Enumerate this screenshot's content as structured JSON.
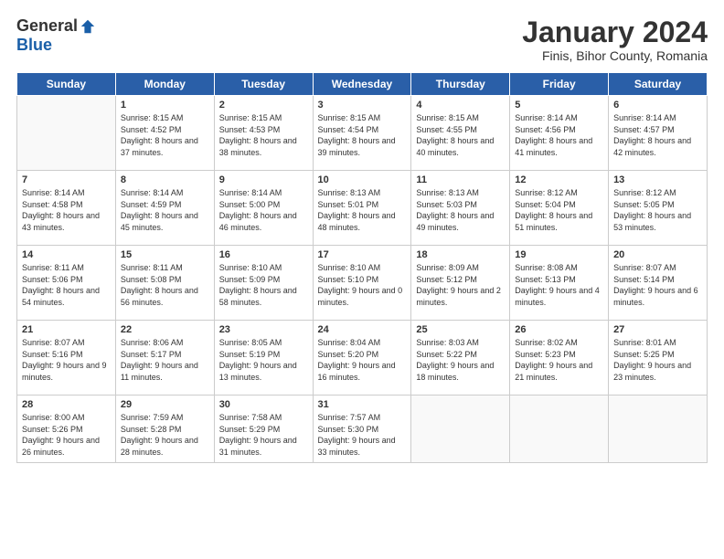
{
  "header": {
    "logo_general": "General",
    "logo_blue": "Blue",
    "title": "January 2024",
    "subtitle": "Finis, Bihor County, Romania"
  },
  "days": [
    "Sunday",
    "Monday",
    "Tuesday",
    "Wednesday",
    "Thursday",
    "Friday",
    "Saturday"
  ],
  "weeks": [
    [
      {
        "date": "",
        "sunrise": "",
        "sunset": "",
        "daylight": ""
      },
      {
        "date": "1",
        "sunrise": "Sunrise: 8:15 AM",
        "sunset": "Sunset: 4:52 PM",
        "daylight": "Daylight: 8 hours and 37 minutes."
      },
      {
        "date": "2",
        "sunrise": "Sunrise: 8:15 AM",
        "sunset": "Sunset: 4:53 PM",
        "daylight": "Daylight: 8 hours and 38 minutes."
      },
      {
        "date": "3",
        "sunrise": "Sunrise: 8:15 AM",
        "sunset": "Sunset: 4:54 PM",
        "daylight": "Daylight: 8 hours and 39 minutes."
      },
      {
        "date": "4",
        "sunrise": "Sunrise: 8:15 AM",
        "sunset": "Sunset: 4:55 PM",
        "daylight": "Daylight: 8 hours and 40 minutes."
      },
      {
        "date": "5",
        "sunrise": "Sunrise: 8:14 AM",
        "sunset": "Sunset: 4:56 PM",
        "daylight": "Daylight: 8 hours and 41 minutes."
      },
      {
        "date": "6",
        "sunrise": "Sunrise: 8:14 AM",
        "sunset": "Sunset: 4:57 PM",
        "daylight": "Daylight: 8 hours and 42 minutes."
      }
    ],
    [
      {
        "date": "7",
        "sunrise": "Sunrise: 8:14 AM",
        "sunset": "Sunset: 4:58 PM",
        "daylight": "Daylight: 8 hours and 43 minutes."
      },
      {
        "date": "8",
        "sunrise": "Sunrise: 8:14 AM",
        "sunset": "Sunset: 4:59 PM",
        "daylight": "Daylight: 8 hours and 45 minutes."
      },
      {
        "date": "9",
        "sunrise": "Sunrise: 8:14 AM",
        "sunset": "Sunset: 5:00 PM",
        "daylight": "Daylight: 8 hours and 46 minutes."
      },
      {
        "date": "10",
        "sunrise": "Sunrise: 8:13 AM",
        "sunset": "Sunset: 5:01 PM",
        "daylight": "Daylight: 8 hours and 48 minutes."
      },
      {
        "date": "11",
        "sunrise": "Sunrise: 8:13 AM",
        "sunset": "Sunset: 5:03 PM",
        "daylight": "Daylight: 8 hours and 49 minutes."
      },
      {
        "date": "12",
        "sunrise": "Sunrise: 8:12 AM",
        "sunset": "Sunset: 5:04 PM",
        "daylight": "Daylight: 8 hours and 51 minutes."
      },
      {
        "date": "13",
        "sunrise": "Sunrise: 8:12 AM",
        "sunset": "Sunset: 5:05 PM",
        "daylight": "Daylight: 8 hours and 53 minutes."
      }
    ],
    [
      {
        "date": "14",
        "sunrise": "Sunrise: 8:11 AM",
        "sunset": "Sunset: 5:06 PM",
        "daylight": "Daylight: 8 hours and 54 minutes."
      },
      {
        "date": "15",
        "sunrise": "Sunrise: 8:11 AM",
        "sunset": "Sunset: 5:08 PM",
        "daylight": "Daylight: 8 hours and 56 minutes."
      },
      {
        "date": "16",
        "sunrise": "Sunrise: 8:10 AM",
        "sunset": "Sunset: 5:09 PM",
        "daylight": "Daylight: 8 hours and 58 minutes."
      },
      {
        "date": "17",
        "sunrise": "Sunrise: 8:10 AM",
        "sunset": "Sunset: 5:10 PM",
        "daylight": "Daylight: 9 hours and 0 minutes."
      },
      {
        "date": "18",
        "sunrise": "Sunrise: 8:09 AM",
        "sunset": "Sunset: 5:12 PM",
        "daylight": "Daylight: 9 hours and 2 minutes."
      },
      {
        "date": "19",
        "sunrise": "Sunrise: 8:08 AM",
        "sunset": "Sunset: 5:13 PM",
        "daylight": "Daylight: 9 hours and 4 minutes."
      },
      {
        "date": "20",
        "sunrise": "Sunrise: 8:07 AM",
        "sunset": "Sunset: 5:14 PM",
        "daylight": "Daylight: 9 hours and 6 minutes."
      }
    ],
    [
      {
        "date": "21",
        "sunrise": "Sunrise: 8:07 AM",
        "sunset": "Sunset: 5:16 PM",
        "daylight": "Daylight: 9 hours and 9 minutes."
      },
      {
        "date": "22",
        "sunrise": "Sunrise: 8:06 AM",
        "sunset": "Sunset: 5:17 PM",
        "daylight": "Daylight: 9 hours and 11 minutes."
      },
      {
        "date": "23",
        "sunrise": "Sunrise: 8:05 AM",
        "sunset": "Sunset: 5:19 PM",
        "daylight": "Daylight: 9 hours and 13 minutes."
      },
      {
        "date": "24",
        "sunrise": "Sunrise: 8:04 AM",
        "sunset": "Sunset: 5:20 PM",
        "daylight": "Daylight: 9 hours and 16 minutes."
      },
      {
        "date": "25",
        "sunrise": "Sunrise: 8:03 AM",
        "sunset": "Sunset: 5:22 PM",
        "daylight": "Daylight: 9 hours and 18 minutes."
      },
      {
        "date": "26",
        "sunrise": "Sunrise: 8:02 AM",
        "sunset": "Sunset: 5:23 PM",
        "daylight": "Daylight: 9 hours and 21 minutes."
      },
      {
        "date": "27",
        "sunrise": "Sunrise: 8:01 AM",
        "sunset": "Sunset: 5:25 PM",
        "daylight": "Daylight: 9 hours and 23 minutes."
      }
    ],
    [
      {
        "date": "28",
        "sunrise": "Sunrise: 8:00 AM",
        "sunset": "Sunset: 5:26 PM",
        "daylight": "Daylight: 9 hours and 26 minutes."
      },
      {
        "date": "29",
        "sunrise": "Sunrise: 7:59 AM",
        "sunset": "Sunset: 5:28 PM",
        "daylight": "Daylight: 9 hours and 28 minutes."
      },
      {
        "date": "30",
        "sunrise": "Sunrise: 7:58 AM",
        "sunset": "Sunset: 5:29 PM",
        "daylight": "Daylight: 9 hours and 31 minutes."
      },
      {
        "date": "31",
        "sunrise": "Sunrise: 7:57 AM",
        "sunset": "Sunset: 5:30 PM",
        "daylight": "Daylight: 9 hours and 33 minutes."
      },
      {
        "date": "",
        "sunrise": "",
        "sunset": "",
        "daylight": ""
      },
      {
        "date": "",
        "sunrise": "",
        "sunset": "",
        "daylight": ""
      },
      {
        "date": "",
        "sunrise": "",
        "sunset": "",
        "daylight": ""
      }
    ]
  ]
}
